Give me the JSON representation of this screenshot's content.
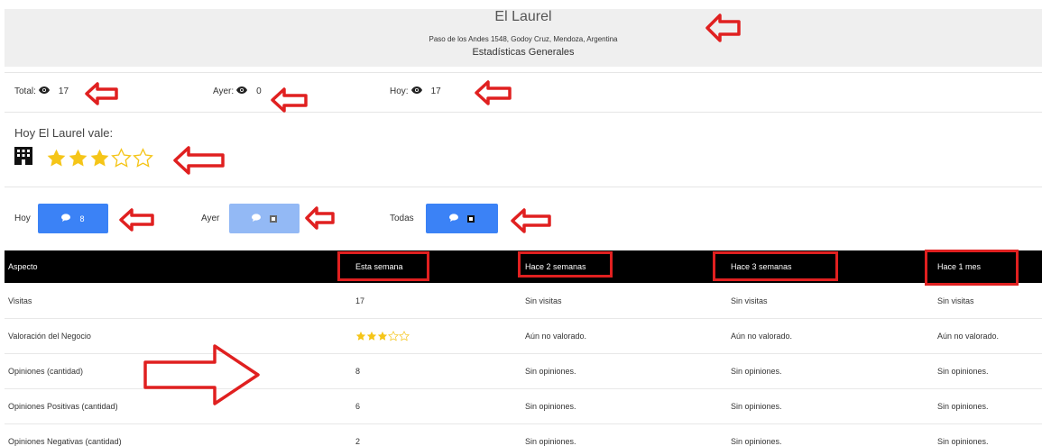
{
  "header": {
    "title": "El Laurel",
    "address": "Paso de los Andes 1548, Godoy Cruz, Mendoza, Argentina",
    "subtitle": "Estadísticas Generales"
  },
  "stats": {
    "total_label": "Total:",
    "total_value": "17",
    "ayer_label": "Ayer:",
    "ayer_value": "0",
    "hoy_label": "Hoy:",
    "hoy_value": "17"
  },
  "valuation": {
    "label": "Hoy El Laurel vale:",
    "rating": 3,
    "max": 5,
    "star_color": "#f5c518"
  },
  "opinions": {
    "hoy_label": "Hoy",
    "hoy_count": "8",
    "ayer_label": "Ayer",
    "todas_label": "Todas",
    "icon": "comment-icon"
  },
  "table": {
    "headers": [
      "Aspecto",
      "Esta semana",
      "Hace 2 semanas",
      "Hace 3 semanas",
      "Hace 1 mes"
    ],
    "rows": [
      [
        "Visitas",
        "17",
        "Sin visitas",
        "Sin visitas",
        "Sin visitas"
      ],
      [
        "Valoración del Negocio",
        "",
        "Aún no valorado.",
        "Aún no valorado.",
        "Aún no valorado."
      ],
      [
        "Opiniones (cantidad)",
        "8",
        "Sin opiniones.",
        "Sin opiniones.",
        "Sin opiniones."
      ],
      [
        "Opiniones Positivas (cantidad)",
        "6",
        "Sin opiniones.",
        "Sin opiniones.",
        "Sin opiniones."
      ],
      [
        "Opiniones Negativas (cantidad)",
        "2",
        "Sin opiniones.",
        "Sin opiniones.",
        "Sin opiniones."
      ]
    ],
    "week_rating": 3
  },
  "colors": {
    "annotation_red": "#e02020",
    "button_blue": "#3b82f6",
    "button_blue_light": "#93b9f5",
    "table_header_bg": "#000000"
  }
}
